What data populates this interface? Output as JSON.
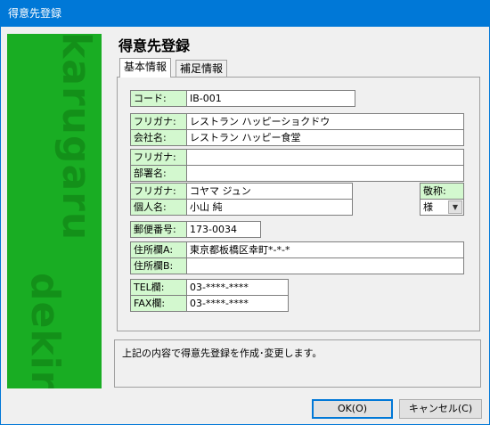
{
  "window": {
    "title": "得意先登録"
  },
  "sidebar": {
    "watermark_top": "karugaru",
    "watermark_bottom": "dekiru",
    "color": "#19ad23"
  },
  "page_title": "得意先登録",
  "tabs": [
    {
      "label": "基本情報",
      "active": true
    },
    {
      "label": "補足情報",
      "active": false
    }
  ],
  "form": {
    "code": {
      "label": "コード:",
      "value": "IB-001"
    },
    "company": {
      "furigana_label": "フリガナ:",
      "furigana_value": "レストラン ハッピーショクドウ",
      "name_label": "会社名:",
      "name_value": "レストラン ハッピー食堂"
    },
    "department": {
      "furigana_label": "フリガナ:",
      "furigana_value": "",
      "name_label": "部署名:",
      "name_value": ""
    },
    "person": {
      "furigana_label": "フリガナ:",
      "furigana_value": "コヤマ ジュン",
      "name_label": "個人名:",
      "name_value": "小山 純"
    },
    "honorific": {
      "label": "敬称:",
      "value": "様"
    },
    "postal": {
      "label": "郵便番号:",
      "value": "173-0034"
    },
    "address": {
      "a_label": "住所欄A:",
      "a_value": "東京都板橋区幸町*-*-*",
      "b_label": "住所欄B:",
      "b_value": ""
    },
    "phone": {
      "tel_label": "TEL欄:",
      "tel_value": "03-****-****",
      "fax_label": "FAX欄:",
      "fax_value": "03-****-****"
    }
  },
  "message": "上記の内容で得意先登録を作成･変更します。",
  "buttons": {
    "ok": "OK(O)",
    "cancel": "キャンセル(C)"
  }
}
